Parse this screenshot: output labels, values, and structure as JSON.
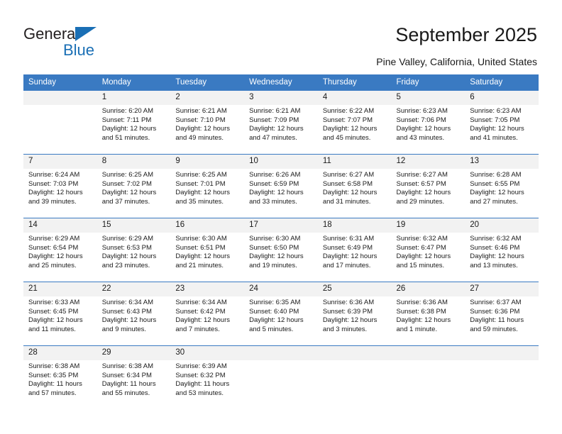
{
  "brand": {
    "name_part1": "General",
    "name_part2": "Blue",
    "accent_color": "#1a6fb5"
  },
  "header": {
    "title": "September 2025",
    "subtitle": "Pine Valley, California, United States"
  },
  "theme": {
    "header_blue": "#3a7ac2",
    "daynum_band": "#f2f2f2",
    "text": "#1a1a1a"
  },
  "labels": {
    "sunrise_prefix": "Sunrise:",
    "sunset_prefix": "Sunset:",
    "daylight_prefix": "Daylight:"
  },
  "weekdays": [
    "Sunday",
    "Monday",
    "Tuesday",
    "Wednesday",
    "Thursday",
    "Friday",
    "Saturday"
  ],
  "weeks": [
    [
      {
        "day": "",
        "sunrise": "",
        "sunset": "",
        "daylight1": "",
        "daylight2": ""
      },
      {
        "day": "1",
        "sunrise": "Sunrise: 6:20 AM",
        "sunset": "Sunset: 7:11 PM",
        "daylight1": "Daylight: 12 hours",
        "daylight2": "and 51 minutes."
      },
      {
        "day": "2",
        "sunrise": "Sunrise: 6:21 AM",
        "sunset": "Sunset: 7:10 PM",
        "daylight1": "Daylight: 12 hours",
        "daylight2": "and 49 minutes."
      },
      {
        "day": "3",
        "sunrise": "Sunrise: 6:21 AM",
        "sunset": "Sunset: 7:09 PM",
        "daylight1": "Daylight: 12 hours",
        "daylight2": "and 47 minutes."
      },
      {
        "day": "4",
        "sunrise": "Sunrise: 6:22 AM",
        "sunset": "Sunset: 7:07 PM",
        "daylight1": "Daylight: 12 hours",
        "daylight2": "and 45 minutes."
      },
      {
        "day": "5",
        "sunrise": "Sunrise: 6:23 AM",
        "sunset": "Sunset: 7:06 PM",
        "daylight1": "Daylight: 12 hours",
        "daylight2": "and 43 minutes."
      },
      {
        "day": "6",
        "sunrise": "Sunrise: 6:23 AM",
        "sunset": "Sunset: 7:05 PM",
        "daylight1": "Daylight: 12 hours",
        "daylight2": "and 41 minutes."
      }
    ],
    [
      {
        "day": "7",
        "sunrise": "Sunrise: 6:24 AM",
        "sunset": "Sunset: 7:03 PM",
        "daylight1": "Daylight: 12 hours",
        "daylight2": "and 39 minutes."
      },
      {
        "day": "8",
        "sunrise": "Sunrise: 6:25 AM",
        "sunset": "Sunset: 7:02 PM",
        "daylight1": "Daylight: 12 hours",
        "daylight2": "and 37 minutes."
      },
      {
        "day": "9",
        "sunrise": "Sunrise: 6:25 AM",
        "sunset": "Sunset: 7:01 PM",
        "daylight1": "Daylight: 12 hours",
        "daylight2": "and 35 minutes."
      },
      {
        "day": "10",
        "sunrise": "Sunrise: 6:26 AM",
        "sunset": "Sunset: 6:59 PM",
        "daylight1": "Daylight: 12 hours",
        "daylight2": "and 33 minutes."
      },
      {
        "day": "11",
        "sunrise": "Sunrise: 6:27 AM",
        "sunset": "Sunset: 6:58 PM",
        "daylight1": "Daylight: 12 hours",
        "daylight2": "and 31 minutes."
      },
      {
        "day": "12",
        "sunrise": "Sunrise: 6:27 AM",
        "sunset": "Sunset: 6:57 PM",
        "daylight1": "Daylight: 12 hours",
        "daylight2": "and 29 minutes."
      },
      {
        "day": "13",
        "sunrise": "Sunrise: 6:28 AM",
        "sunset": "Sunset: 6:55 PM",
        "daylight1": "Daylight: 12 hours",
        "daylight2": "and 27 minutes."
      }
    ],
    [
      {
        "day": "14",
        "sunrise": "Sunrise: 6:29 AM",
        "sunset": "Sunset: 6:54 PM",
        "daylight1": "Daylight: 12 hours",
        "daylight2": "and 25 minutes."
      },
      {
        "day": "15",
        "sunrise": "Sunrise: 6:29 AM",
        "sunset": "Sunset: 6:53 PM",
        "daylight1": "Daylight: 12 hours",
        "daylight2": "and 23 minutes."
      },
      {
        "day": "16",
        "sunrise": "Sunrise: 6:30 AM",
        "sunset": "Sunset: 6:51 PM",
        "daylight1": "Daylight: 12 hours",
        "daylight2": "and 21 minutes."
      },
      {
        "day": "17",
        "sunrise": "Sunrise: 6:30 AM",
        "sunset": "Sunset: 6:50 PM",
        "daylight1": "Daylight: 12 hours",
        "daylight2": "and 19 minutes."
      },
      {
        "day": "18",
        "sunrise": "Sunrise: 6:31 AM",
        "sunset": "Sunset: 6:49 PM",
        "daylight1": "Daylight: 12 hours",
        "daylight2": "and 17 minutes."
      },
      {
        "day": "19",
        "sunrise": "Sunrise: 6:32 AM",
        "sunset": "Sunset: 6:47 PM",
        "daylight1": "Daylight: 12 hours",
        "daylight2": "and 15 minutes."
      },
      {
        "day": "20",
        "sunrise": "Sunrise: 6:32 AM",
        "sunset": "Sunset: 6:46 PM",
        "daylight1": "Daylight: 12 hours",
        "daylight2": "and 13 minutes."
      }
    ],
    [
      {
        "day": "21",
        "sunrise": "Sunrise: 6:33 AM",
        "sunset": "Sunset: 6:45 PM",
        "daylight1": "Daylight: 12 hours",
        "daylight2": "and 11 minutes."
      },
      {
        "day": "22",
        "sunrise": "Sunrise: 6:34 AM",
        "sunset": "Sunset: 6:43 PM",
        "daylight1": "Daylight: 12 hours",
        "daylight2": "and 9 minutes."
      },
      {
        "day": "23",
        "sunrise": "Sunrise: 6:34 AM",
        "sunset": "Sunset: 6:42 PM",
        "daylight1": "Daylight: 12 hours",
        "daylight2": "and 7 minutes."
      },
      {
        "day": "24",
        "sunrise": "Sunrise: 6:35 AM",
        "sunset": "Sunset: 6:40 PM",
        "daylight1": "Daylight: 12 hours",
        "daylight2": "and 5 minutes."
      },
      {
        "day": "25",
        "sunrise": "Sunrise: 6:36 AM",
        "sunset": "Sunset: 6:39 PM",
        "daylight1": "Daylight: 12 hours",
        "daylight2": "and 3 minutes."
      },
      {
        "day": "26",
        "sunrise": "Sunrise: 6:36 AM",
        "sunset": "Sunset: 6:38 PM",
        "daylight1": "Daylight: 12 hours",
        "daylight2": "and 1 minute."
      },
      {
        "day": "27",
        "sunrise": "Sunrise: 6:37 AM",
        "sunset": "Sunset: 6:36 PM",
        "daylight1": "Daylight: 11 hours",
        "daylight2": "and 59 minutes."
      }
    ],
    [
      {
        "day": "28",
        "sunrise": "Sunrise: 6:38 AM",
        "sunset": "Sunset: 6:35 PM",
        "daylight1": "Daylight: 11 hours",
        "daylight2": "and 57 minutes."
      },
      {
        "day": "29",
        "sunrise": "Sunrise: 6:38 AM",
        "sunset": "Sunset: 6:34 PM",
        "daylight1": "Daylight: 11 hours",
        "daylight2": "and 55 minutes."
      },
      {
        "day": "30",
        "sunrise": "Sunrise: 6:39 AM",
        "sunset": "Sunset: 6:32 PM",
        "daylight1": "Daylight: 11 hours",
        "daylight2": "and 53 minutes."
      },
      {
        "day": "",
        "sunrise": "",
        "sunset": "",
        "daylight1": "",
        "daylight2": ""
      },
      {
        "day": "",
        "sunrise": "",
        "sunset": "",
        "daylight1": "",
        "daylight2": ""
      },
      {
        "day": "",
        "sunrise": "",
        "sunset": "",
        "daylight1": "",
        "daylight2": ""
      },
      {
        "day": "",
        "sunrise": "",
        "sunset": "",
        "daylight1": "",
        "daylight2": ""
      }
    ]
  ]
}
